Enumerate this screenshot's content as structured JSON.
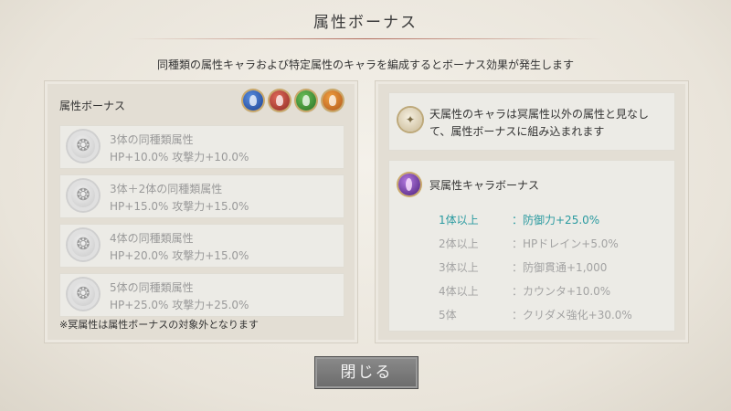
{
  "header": {
    "title": "属性ボーナス",
    "subtitle": "同種類の属性キャラおよび特定属性のキャラを編成するとボーナス効果が発生します"
  },
  "left_panel": {
    "heading": "属性ボーナス",
    "element_icons": [
      "water-icon",
      "fire-icon",
      "wind-icon",
      "earth-icon"
    ],
    "bonuses": [
      {
        "name": "3体の同種類属性",
        "stats": "HP+10.0% 攻撃力+10.0%"
      },
      {
        "name": "3体＋2体の同種類属性",
        "stats": "HP+15.0% 攻撃力+15.0%"
      },
      {
        "name": "4体の同種類属性",
        "stats": "HP+20.0% 攻撃力+15.0%"
      },
      {
        "name": "5体の同種類属性",
        "stats": "HP+25.0% 攻撃力+25.0%"
      }
    ],
    "note": "※冥属性は属性ボーナスの対象外となります"
  },
  "right_panel": {
    "info_line1": "天属性のキャラは冥属性以外の属性と見なし",
    "info_line2": "て、属性ボーナスに組み込まれます",
    "dark_title": "冥属性キャラボーナス",
    "tiers": [
      {
        "count": "1体以上",
        "effect": "：防御力+25.0%",
        "active": true
      },
      {
        "count": "2体以上",
        "effect": "：HPドレイン+5.0%",
        "active": false
      },
      {
        "count": "3体以上",
        "effect": "：防御貫通+1,000",
        "active": false
      },
      {
        "count": "4体以上",
        "effect": "：カウンタ+10.0%",
        "active": false
      },
      {
        "count": "5体",
        "effect": "：クリダメ強化+30.0%",
        "active": false
      }
    ]
  },
  "footer": {
    "close_label": "閉じる"
  },
  "colors": {
    "active_tier": "#2a9aa0",
    "inactive_text": "#a3a3a3",
    "accent_rule": "#b06a5a"
  }
}
